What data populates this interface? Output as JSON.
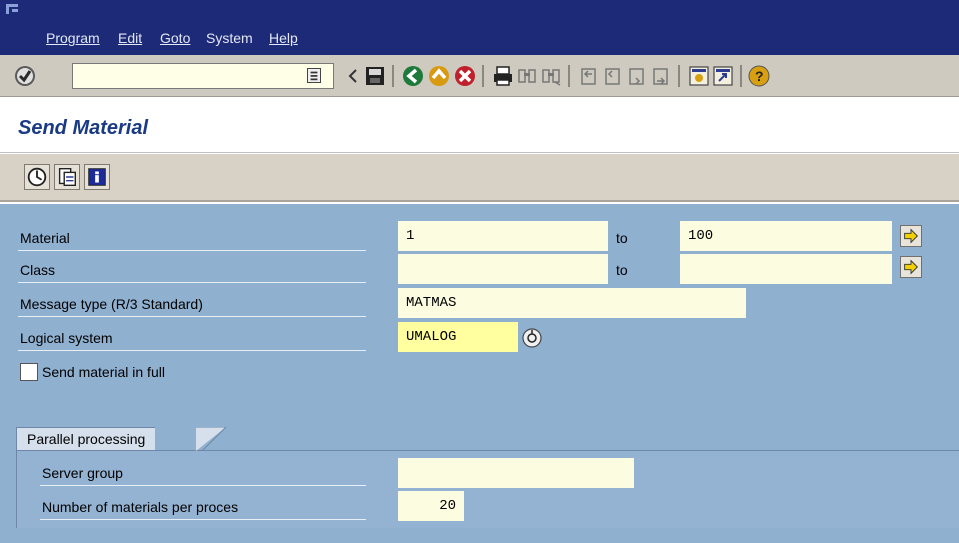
{
  "menu": {
    "items": [
      {
        "label": "Program"
      },
      {
        "label": "Edit"
      },
      {
        "label": "Goto"
      },
      {
        "label": "System"
      },
      {
        "label": "Help"
      }
    ]
  },
  "toolbar": {
    "command_value": ""
  },
  "title": "Send Material",
  "form": {
    "material_label": "Material",
    "material_from": "1",
    "material_to": "100",
    "class_label": "Class",
    "class_from": "",
    "class_to": "",
    "to_label": "to",
    "message_type_label": "Message type (R/3 Standard)",
    "message_type_value": "MATMAS",
    "logical_system_label": "Logical system",
    "logical_system_value": "UMALOG",
    "send_full_label": "Send material in full",
    "send_full_checked": false
  },
  "parallel": {
    "group_title": "Parallel processing",
    "server_group_label": "Server group",
    "server_group_value": "",
    "num_materials_label": "Number of materials per proces",
    "num_materials_value": "20"
  },
  "colors": {
    "menu_bg": "#1c2a78",
    "toolbar_bg": "#cfcac0",
    "title_color": "#1a3a86",
    "form_bg": "#90b0d0",
    "field_bg": "#fcfce0"
  },
  "icons": {
    "system_menu": "sap-system-icon",
    "enter": "check-icon",
    "save": "save-icon",
    "back": "back-icon",
    "exit": "exit-icon",
    "cancel": "cancel-icon",
    "print": "print-icon",
    "find": "find-icon",
    "find_next": "find-next-icon",
    "first_page": "first-page-icon",
    "prev_page": "previous-page-icon",
    "next_page": "next-page-icon",
    "last_page": "last-page-icon",
    "new_session": "new-session-icon",
    "shortcut": "shortcut-icon",
    "help": "help-icon",
    "execute": "execute-icon",
    "get_variant": "get-variant-icon",
    "program_doc": "info-icon",
    "multiple_selection": "arrow-right-icon",
    "f4_help": "value-help-icon"
  }
}
